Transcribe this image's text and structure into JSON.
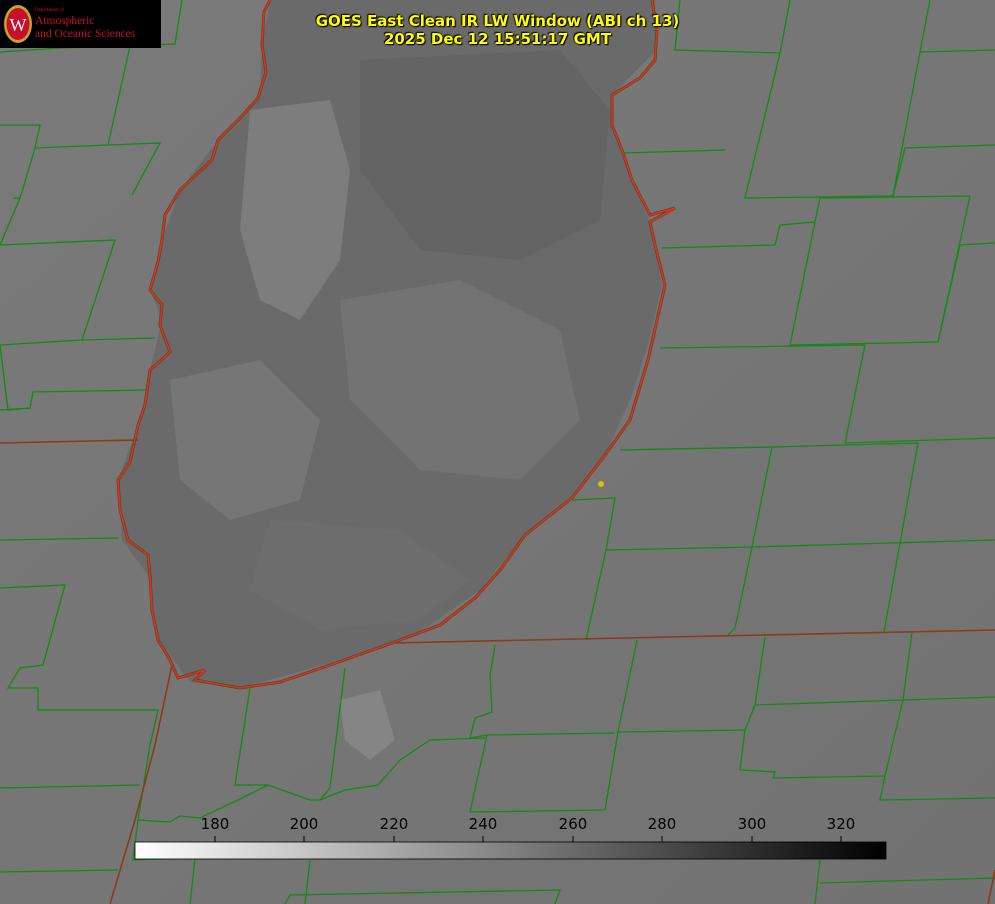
{
  "logo": {
    "seal_letter": "W",
    "dept_small": "Department of",
    "line1": "Atmospheric",
    "line2": "and Oceanic Sciences",
    "color": "#c8102e"
  },
  "header": {
    "title_line1": "GOES East Clean IR LW Window (ABI ch 13)",
    "title_line2": "2025 Dec 12 15:51:17 GMT",
    "color": "#ffff00"
  },
  "colorbar": {
    "ticks": [
      "180",
      "200",
      "220",
      "240",
      "260",
      "280",
      "300",
      "320"
    ],
    "min": 162,
    "max": 330,
    "gradient": [
      "#ffffff",
      "#000000"
    ]
  },
  "map_colors": {
    "county_lines": "#138a13",
    "state_lines": "#8b3a1a",
    "lake_outline": "#ff2020",
    "station_dot": "#d9c200"
  }
}
